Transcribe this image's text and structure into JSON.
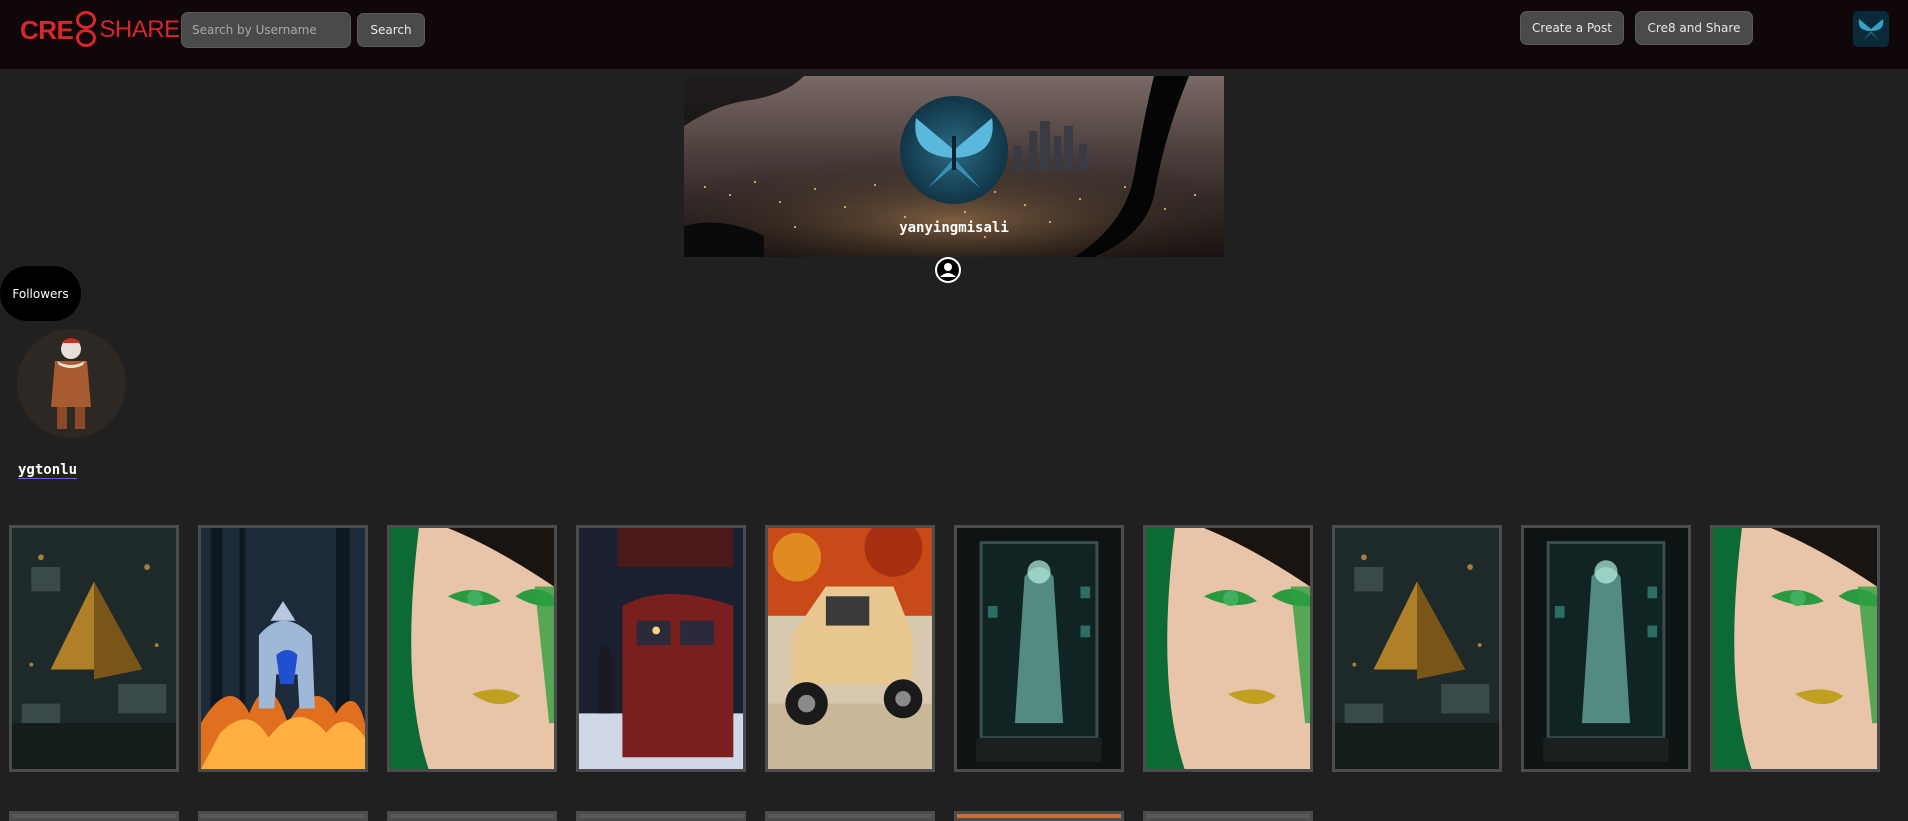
{
  "logo": {
    "part1": "CRE",
    "part2": "SHARE"
  },
  "search": {
    "placeholder": "Search by Username",
    "button": "Search"
  },
  "nav": {
    "create_post": "Create a Post",
    "cre8_share": "Cre8 and Share"
  },
  "profile": {
    "username": "yanyingmisali"
  },
  "followers": {
    "label": "Followers",
    "items": [
      {
        "username": "ygtonlu"
      }
    ]
  },
  "posts": [
    {
      "subject": "pyramid-circuit-board"
    },
    {
      "subject": "blue-wolf-fire-forest"
    },
    {
      "subject": "green-glitter-makeup-face"
    },
    {
      "subject": "red-train-winter"
    },
    {
      "subject": "wicker-hot-rod-truck"
    },
    {
      "subject": "ghost-in-glass-case"
    },
    {
      "subject": "green-glitter-makeup-face"
    },
    {
      "subject": "pyramid-circuit-board"
    },
    {
      "subject": "ghost-in-glass-case"
    },
    {
      "subject": "green-glitter-makeup-face"
    }
  ],
  "colors": {
    "brand": "#d7262c",
    "background": "#202020",
    "topbar": "#0f0709",
    "button": "#4a4a4a"
  }
}
